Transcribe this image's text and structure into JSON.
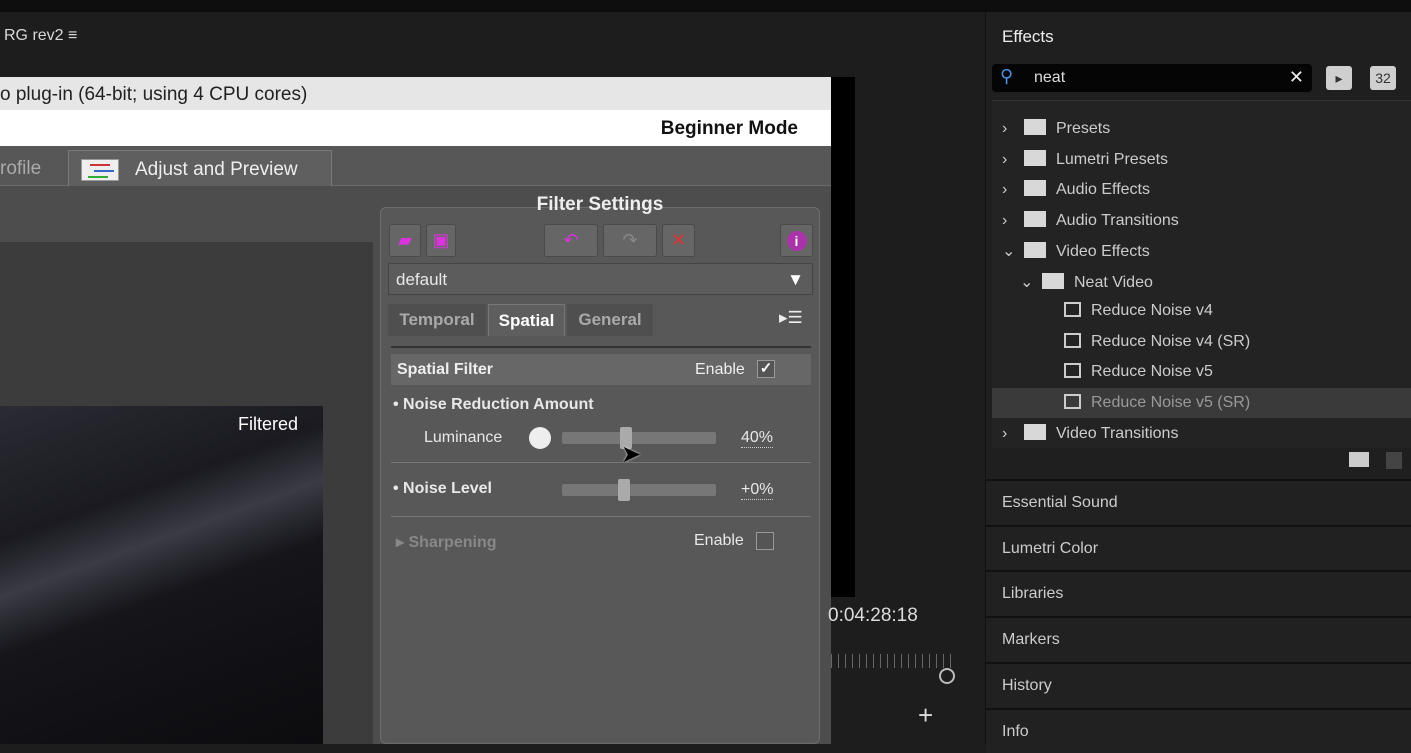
{
  "sequence": {
    "title": "RG rev2",
    "menu_icon": "hamburger-icon"
  },
  "dialog": {
    "title": "o plug-in (64-bit; using 4 CPU cores)",
    "mode": "Beginner Mode",
    "tabs": [
      {
        "label": "rofile"
      },
      {
        "label": "Adjust and Preview",
        "active": true
      }
    ],
    "preview_label": "Filtered",
    "filter_settings": {
      "title": "Filter Settings",
      "preset": "default",
      "tabs": [
        "Temporal",
        "Spatial",
        "General"
      ],
      "active_tab": "Spatial",
      "spatial_filter": {
        "label": "Spatial Filter",
        "enable_label": "Enable",
        "enabled": true
      },
      "noise_reduction": {
        "label": "Noise Reduction Amount",
        "luminance_label": "Luminance",
        "luminance_value": "40%"
      },
      "noise_level": {
        "label": "Noise Level",
        "value": "+0%"
      },
      "sharpening": {
        "label": "Sharpening",
        "enable_label": "Enable",
        "enabled": false
      }
    },
    "accent": "#cc33cc"
  },
  "monitor": {
    "timecode": "0:04:28:18"
  },
  "effects": {
    "title": "Effects",
    "search_value": "neat",
    "badge_32": "32",
    "tree": [
      {
        "label": "Presets",
        "depth": 0,
        "expanded": false,
        "type": "preset-folder"
      },
      {
        "label": "Lumetri Presets",
        "depth": 0,
        "expanded": false,
        "type": "preset-folder"
      },
      {
        "label": "Audio Effects",
        "depth": 0,
        "expanded": false,
        "type": "folder"
      },
      {
        "label": "Audio Transitions",
        "depth": 0,
        "expanded": false,
        "type": "folder"
      },
      {
        "label": "Video Effects",
        "depth": 0,
        "expanded": true,
        "type": "folder"
      },
      {
        "label": "Neat Video",
        "depth": 1,
        "expanded": true,
        "type": "folder"
      },
      {
        "label": "Reduce Noise v4",
        "depth": 2,
        "type": "effect"
      },
      {
        "label": "Reduce Noise v4 (SR)",
        "depth": 2,
        "type": "effect"
      },
      {
        "label": "Reduce Noise v5",
        "depth": 2,
        "type": "effect"
      },
      {
        "label": "Reduce Noise v5 (SR)",
        "depth": 2,
        "type": "effect",
        "selected": true
      },
      {
        "label": "Video Transitions",
        "depth": 0,
        "expanded": false,
        "type": "folder"
      }
    ],
    "panels": [
      "Essential Sound",
      "Lumetri Color",
      "Libraries",
      "Markers",
      "History",
      "Info"
    ]
  }
}
